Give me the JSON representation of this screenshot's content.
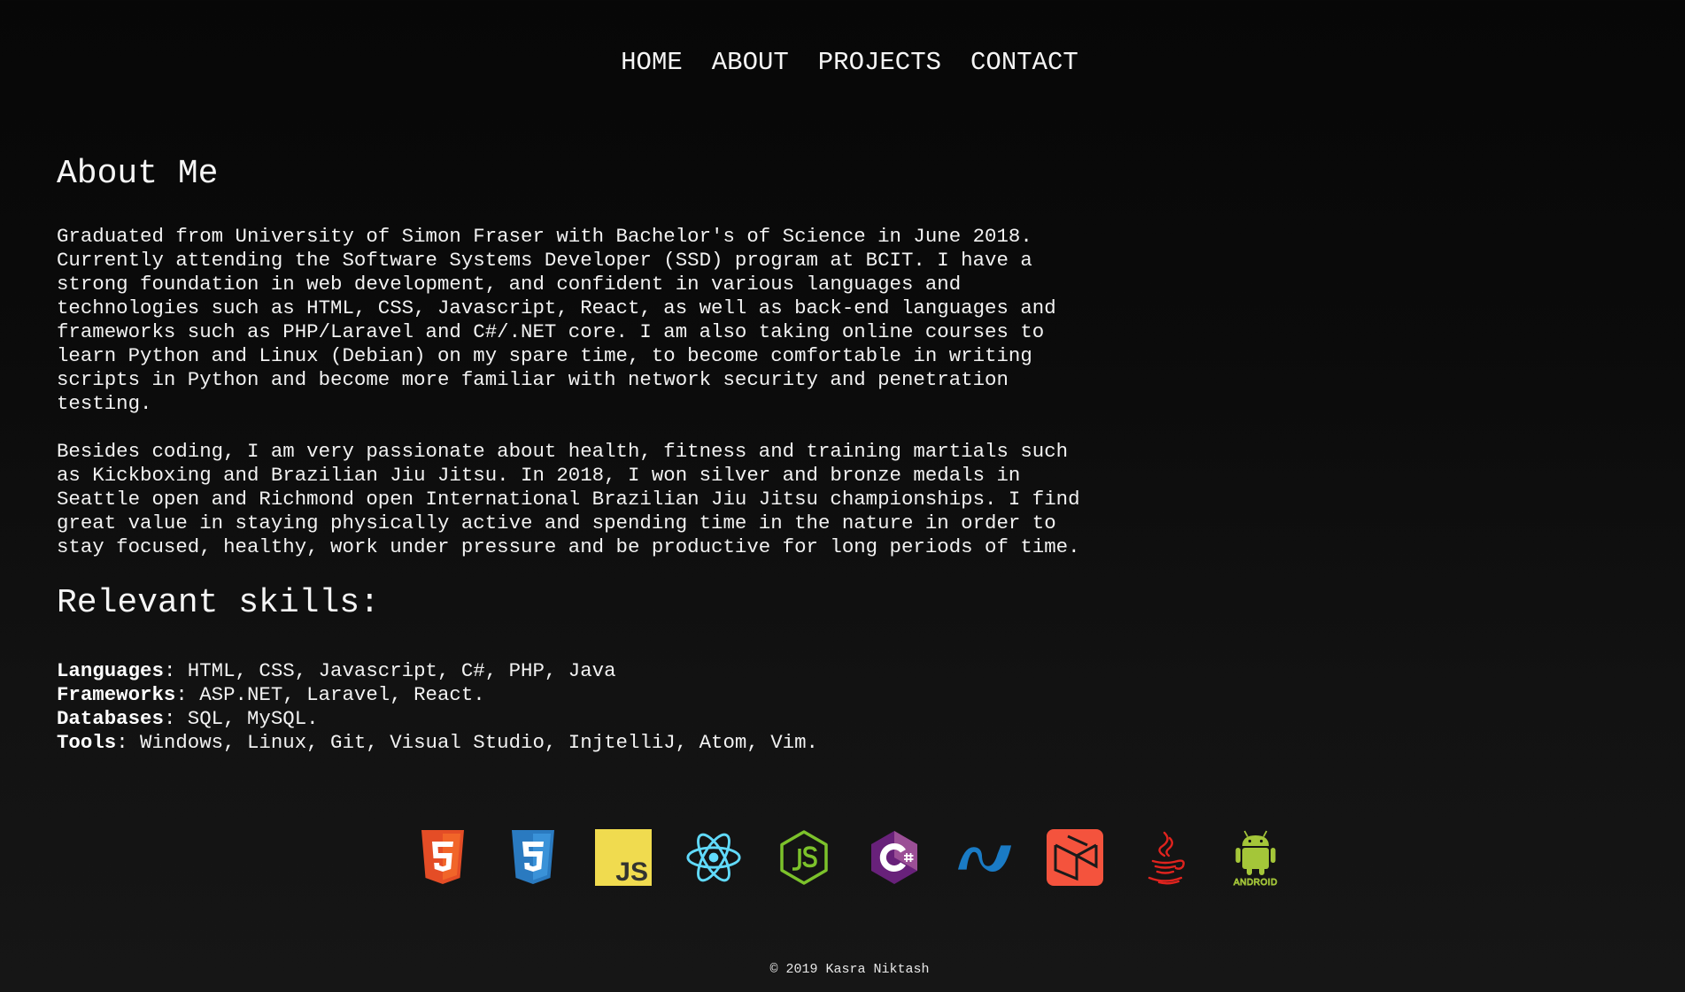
{
  "nav": {
    "items": [
      {
        "label": "HOME"
      },
      {
        "label": "ABOUT"
      },
      {
        "label": "PROJECTS"
      },
      {
        "label": "CONTACT"
      }
    ]
  },
  "about": {
    "title": "About Me",
    "paragraph1": "Graduated from University of Simon Fraser with Bachelor's of Science in June 2018.\nCurrently attending the Software Systems Developer (SSD) program at BCIT. I have a\nstrong foundation in web development, and confident in various languages and\ntechnologies such as HTML, CSS, Javascript, React, as well as back-end languages and\nframeworks such as PHP/Laravel and C#/.NET core. I am also taking online courses to\nlearn Python and Linux (Debian) on my spare time, to become comfortable in writing\nscripts in Python and become more familiar with network security and penetration\ntesting.",
    "paragraph2": "Besides coding, I am very passionate about health, fitness and training martials such\nas Kickboxing and Brazilian Jiu Jitsu. In 2018, I won silver and bronze medals in\nSeattle open and Richmond open International Brazilian Jiu Jitsu championships. I find\ngreat value in staying physically active and spending time in the nature in order to\nstay focused, healthy, work under pressure and be productive for long periods of time."
  },
  "skills": {
    "title": "Relevant skills:",
    "rows": [
      {
        "label": "Languages",
        "value": ": HTML, CSS, Javascript, C#, PHP, Java"
      },
      {
        "label": "Frameworks",
        "value": ": ASP.NET, Laravel, React."
      },
      {
        "label": "Databases",
        "value": ": SQL, MySQL."
      },
      {
        "label": "Tools",
        "value": ": Windows, Linux, Git, Visual Studio, InjtelliJ, Atom, Vim."
      }
    ]
  },
  "icons": {
    "html5": "html5-icon",
    "css3": "css3-icon",
    "js": "javascript-icon",
    "js_text": "JS",
    "react": "react-icon",
    "node": "nodejs-icon",
    "csharp": "csharp-icon",
    "dotnet": "dotnet-icon",
    "laravel": "laravel-icon",
    "java": "java-icon",
    "android": "android-icon",
    "android_text": "ANDROID"
  },
  "colors": {
    "html5": "#e44d26",
    "css3": "#2965f1",
    "js_bg": "#f0db4f",
    "react": "#61dafb",
    "node": "#68a063",
    "csharp": "#68217a",
    "dotnet": "#1a7bc5",
    "laravel": "#f4533d",
    "java": "#e01e1e",
    "android": "#a4c639"
  },
  "footer": {
    "text": "© 2019 Kasra Niktash"
  }
}
